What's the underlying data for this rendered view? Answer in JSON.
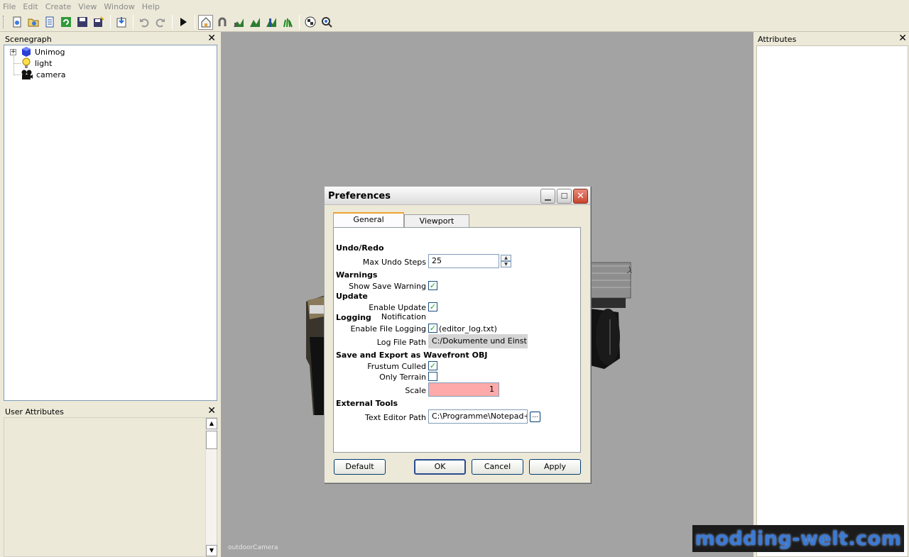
{
  "menu": {
    "items": [
      "File",
      "Edit",
      "Create",
      "View",
      "Window",
      "Help"
    ]
  },
  "toolbar": {
    "buttons": [
      "new-icon",
      "open-icon",
      "list-icon",
      "refresh-icon",
      "save-icon",
      "save-as-icon",
      "import-icon",
      "undo-icon",
      "redo-icon",
      "play-icon",
      "home-icon",
      "magnet-icon",
      "terrain-paint-icon",
      "terrain-smooth-icon",
      "terrain-height-icon",
      "foliage-icon",
      "checker-icon",
      "debug-icon"
    ]
  },
  "scenegraph": {
    "title": "Scenegraph",
    "nodes": [
      {
        "label": "Unimog",
        "icon": "cube-icon"
      },
      {
        "label": "light",
        "icon": "bulb-icon"
      },
      {
        "label": "camera",
        "icon": "camera-icon"
      }
    ]
  },
  "user_attributes": {
    "title": "User Attributes"
  },
  "attributes": {
    "title": "Attributes"
  },
  "viewport": {
    "camera_label": "outdoorCamera"
  },
  "watermark": {
    "text": "modding-welt.com"
  },
  "dialog": {
    "title": "Preferences",
    "tabs": [
      "General",
      "Viewport"
    ],
    "sections": {
      "undo": "Undo/Redo",
      "warnings": "Warnings",
      "update": "Update",
      "logging": "Logging",
      "save_export": "Save and Export as Wavefront OBJ",
      "external": "External Tools"
    },
    "fields": {
      "max_undo_label": "Max Undo Steps",
      "max_undo_value": "25",
      "show_save_warning_label": "Show Save Warning",
      "enable_update_label": "Enable Update Notification",
      "enable_logging_label": "Enable File Logging",
      "enable_logging_note": "(editor_log.txt)",
      "log_path_label": "Log File Path",
      "log_path_value": "C:/Dokumente und Einstellu",
      "frustum_label": "Frustum Culled",
      "only_terrain_label": "Only Terrain",
      "scale_label": "Scale",
      "scale_value": "1",
      "text_editor_label": "Text Editor Path",
      "text_editor_value": "C:\\Programme\\Notepad++",
      "browse_label": "..."
    },
    "checks": {
      "show_save_warning": true,
      "enable_update": true,
      "enable_logging": true,
      "frustum_culled": true,
      "only_terrain": false
    },
    "buttons": {
      "default": "Default",
      "ok": "OK",
      "cancel": "Cancel",
      "apply": "Apply"
    }
  },
  "colors": {
    "viewport_bg": "#a3a3a3",
    "scale_error_bg": "#ffaaaa",
    "tab_accent": "#f0a030",
    "check": "#21a121"
  }
}
